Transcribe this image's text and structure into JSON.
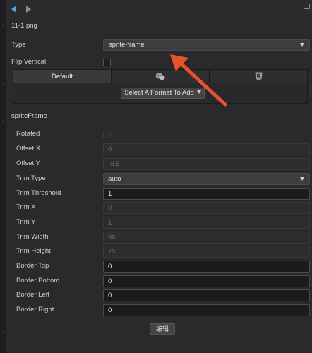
{
  "header": {
    "filename": "11-1.png"
  },
  "properties": {
    "type": {
      "label": "Type",
      "value": "sprite-frame"
    },
    "flip_vertical": {
      "label": "Flip Vertical",
      "checked": false
    }
  },
  "platform_tabs": {
    "tabs": [
      {
        "label": "Default",
        "icon": ""
      },
      {
        "label": "",
        "icon": "wechat-icon"
      },
      {
        "label": "",
        "icon": "html5-icon"
      }
    ],
    "format_button": "Select A Format To Add"
  },
  "sprite_frame": {
    "section_title": "spriteFrame",
    "rotated": {
      "label": "Rotated",
      "checked": false
    },
    "offset_x": {
      "label": "Offset X",
      "value": "0"
    },
    "offset_y": {
      "label": "Offset Y",
      "value": "-0.5"
    },
    "trim_type": {
      "label": "Trim Type",
      "value": "auto"
    },
    "trim_threshold": {
      "label": "Trim Threshold",
      "value": "1"
    },
    "trim_x": {
      "label": "Trim X",
      "value": "0"
    },
    "trim_y": {
      "label": "Trim Y",
      "value": "1"
    },
    "trim_width": {
      "label": "Trim Width",
      "value": "96"
    },
    "trim_height": {
      "label": "Trim Height",
      "value": "75"
    },
    "border_top": {
      "label": "Border Top",
      "value": "0"
    },
    "border_bottom": {
      "label": "Border Bottom",
      "value": "0"
    },
    "border_left": {
      "label": "Border Left",
      "value": "0"
    },
    "border_right": {
      "label": "Border Right",
      "value": "0"
    }
  },
  "edit_button": "编辑",
  "colors": {
    "accent": "#4aa6e3",
    "annotation_arrow": "#e8532b",
    "panel_bg": "#2a2a2c"
  }
}
